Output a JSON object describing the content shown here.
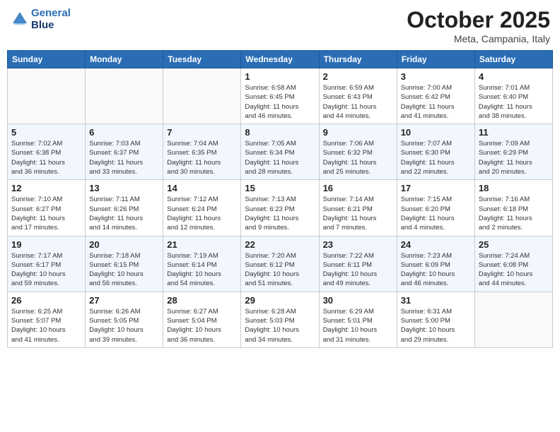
{
  "header": {
    "logo_line1": "General",
    "logo_line2": "Blue",
    "month": "October 2025",
    "location": "Meta, Campania, Italy"
  },
  "weekdays": [
    "Sunday",
    "Monday",
    "Tuesday",
    "Wednesday",
    "Thursday",
    "Friday",
    "Saturday"
  ],
  "weeks": [
    [
      {
        "day": "",
        "info": ""
      },
      {
        "day": "",
        "info": ""
      },
      {
        "day": "",
        "info": ""
      },
      {
        "day": "1",
        "info": "Sunrise: 6:58 AM\nSunset: 6:45 PM\nDaylight: 11 hours\nand 46 minutes."
      },
      {
        "day": "2",
        "info": "Sunrise: 6:59 AM\nSunset: 6:43 PM\nDaylight: 11 hours\nand 44 minutes."
      },
      {
        "day": "3",
        "info": "Sunrise: 7:00 AM\nSunset: 6:42 PM\nDaylight: 11 hours\nand 41 minutes."
      },
      {
        "day": "4",
        "info": "Sunrise: 7:01 AM\nSunset: 6:40 PM\nDaylight: 11 hours\nand 38 minutes."
      }
    ],
    [
      {
        "day": "5",
        "info": "Sunrise: 7:02 AM\nSunset: 6:38 PM\nDaylight: 11 hours\nand 36 minutes."
      },
      {
        "day": "6",
        "info": "Sunrise: 7:03 AM\nSunset: 6:37 PM\nDaylight: 11 hours\nand 33 minutes."
      },
      {
        "day": "7",
        "info": "Sunrise: 7:04 AM\nSunset: 6:35 PM\nDaylight: 11 hours\nand 30 minutes."
      },
      {
        "day": "8",
        "info": "Sunrise: 7:05 AM\nSunset: 6:34 PM\nDaylight: 11 hours\nand 28 minutes."
      },
      {
        "day": "9",
        "info": "Sunrise: 7:06 AM\nSunset: 6:32 PM\nDaylight: 11 hours\nand 25 minutes."
      },
      {
        "day": "10",
        "info": "Sunrise: 7:07 AM\nSunset: 6:30 PM\nDaylight: 11 hours\nand 22 minutes."
      },
      {
        "day": "11",
        "info": "Sunrise: 7:09 AM\nSunset: 6:29 PM\nDaylight: 11 hours\nand 20 minutes."
      }
    ],
    [
      {
        "day": "12",
        "info": "Sunrise: 7:10 AM\nSunset: 6:27 PM\nDaylight: 11 hours\nand 17 minutes."
      },
      {
        "day": "13",
        "info": "Sunrise: 7:11 AM\nSunset: 6:26 PM\nDaylight: 11 hours\nand 14 minutes."
      },
      {
        "day": "14",
        "info": "Sunrise: 7:12 AM\nSunset: 6:24 PM\nDaylight: 11 hours\nand 12 minutes."
      },
      {
        "day": "15",
        "info": "Sunrise: 7:13 AM\nSunset: 6:23 PM\nDaylight: 11 hours\nand 9 minutes."
      },
      {
        "day": "16",
        "info": "Sunrise: 7:14 AM\nSunset: 6:21 PM\nDaylight: 11 hours\nand 7 minutes."
      },
      {
        "day": "17",
        "info": "Sunrise: 7:15 AM\nSunset: 6:20 PM\nDaylight: 11 hours\nand 4 minutes."
      },
      {
        "day": "18",
        "info": "Sunrise: 7:16 AM\nSunset: 6:18 PM\nDaylight: 11 hours\nand 2 minutes."
      }
    ],
    [
      {
        "day": "19",
        "info": "Sunrise: 7:17 AM\nSunset: 6:17 PM\nDaylight: 10 hours\nand 59 minutes."
      },
      {
        "day": "20",
        "info": "Sunrise: 7:18 AM\nSunset: 6:15 PM\nDaylight: 10 hours\nand 56 minutes."
      },
      {
        "day": "21",
        "info": "Sunrise: 7:19 AM\nSunset: 6:14 PM\nDaylight: 10 hours\nand 54 minutes."
      },
      {
        "day": "22",
        "info": "Sunrise: 7:20 AM\nSunset: 6:12 PM\nDaylight: 10 hours\nand 51 minutes."
      },
      {
        "day": "23",
        "info": "Sunrise: 7:22 AM\nSunset: 6:11 PM\nDaylight: 10 hours\nand 49 minutes."
      },
      {
        "day": "24",
        "info": "Sunrise: 7:23 AM\nSunset: 6:09 PM\nDaylight: 10 hours\nand 46 minutes."
      },
      {
        "day": "25",
        "info": "Sunrise: 7:24 AM\nSunset: 6:08 PM\nDaylight: 10 hours\nand 44 minutes."
      }
    ],
    [
      {
        "day": "26",
        "info": "Sunrise: 6:25 AM\nSunset: 5:07 PM\nDaylight: 10 hours\nand 41 minutes."
      },
      {
        "day": "27",
        "info": "Sunrise: 6:26 AM\nSunset: 5:05 PM\nDaylight: 10 hours\nand 39 minutes."
      },
      {
        "day": "28",
        "info": "Sunrise: 6:27 AM\nSunset: 5:04 PM\nDaylight: 10 hours\nand 36 minutes."
      },
      {
        "day": "29",
        "info": "Sunrise: 6:28 AM\nSunset: 5:03 PM\nDaylight: 10 hours\nand 34 minutes."
      },
      {
        "day": "30",
        "info": "Sunrise: 6:29 AM\nSunset: 5:01 PM\nDaylight: 10 hours\nand 31 minutes."
      },
      {
        "day": "31",
        "info": "Sunrise: 6:31 AM\nSunset: 5:00 PM\nDaylight: 10 hours\nand 29 minutes."
      },
      {
        "day": "",
        "info": ""
      }
    ]
  ]
}
